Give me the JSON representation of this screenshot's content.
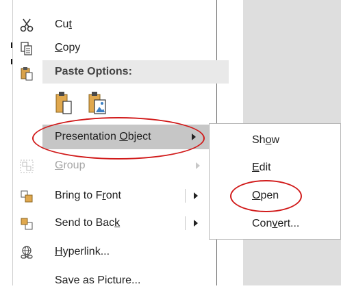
{
  "context_menu": {
    "items": [
      {
        "name": "cut",
        "icon": "scissors-icon",
        "pre": "Cu",
        "ul": "t",
        "post": "",
        "has_arrow": false,
        "disabled": false
      },
      {
        "name": "copy",
        "icon": "copy-icon",
        "pre": "",
        "ul": "C",
        "post": "opy",
        "has_arrow": false,
        "disabled": false
      },
      {
        "name": "presentation-object",
        "icon": "",
        "pre": "Presentation ",
        "ul": "O",
        "post": "bject",
        "has_arrow": true,
        "disabled": false
      },
      {
        "name": "group",
        "icon": "group-icon",
        "pre": "",
        "ul": "G",
        "post": "roup",
        "has_arrow": true,
        "disabled": true
      },
      {
        "name": "bring-to-front",
        "icon": "bring-to-front-icon",
        "pre": "Bring to F",
        "ul": "r",
        "post": "ont",
        "has_arrow": true,
        "disabled": false
      },
      {
        "name": "send-to-back",
        "icon": "send-to-back-icon",
        "pre": "Send to Bac",
        "ul": "k",
        "post": "",
        "has_arrow": true,
        "disabled": false
      },
      {
        "name": "hyperlink",
        "icon": "hyperlink-icon",
        "pre": "",
        "ul": "H",
        "post": "yperlink...",
        "has_arrow": false,
        "disabled": false
      },
      {
        "name": "save-as-picture",
        "icon": "",
        "pre": "Save as Picture...",
        "ul": "",
        "post": "",
        "has_arrow": false,
        "disabled": false
      }
    ],
    "paste_options_label": "Paste Options:",
    "paste_buttons": [
      "paste-keep-format-icon",
      "paste-as-picture-icon"
    ]
  },
  "submenu": {
    "items": [
      {
        "name": "show",
        "pre": "Sh",
        "ul": "o",
        "post": "w"
      },
      {
        "name": "edit",
        "pre": "",
        "ul": "E",
        "post": "dit"
      },
      {
        "name": "open",
        "pre": "",
        "ul": "O",
        "post": "pen"
      },
      {
        "name": "convert",
        "pre": "Con",
        "ul": "v",
        "post": "ert..."
      }
    ]
  },
  "colors": {
    "highlight": "#c6c6c6",
    "annotation": "#d11a1a",
    "disabled_text": "#a6a6a6",
    "header_bg": "#e9e9e9"
  }
}
